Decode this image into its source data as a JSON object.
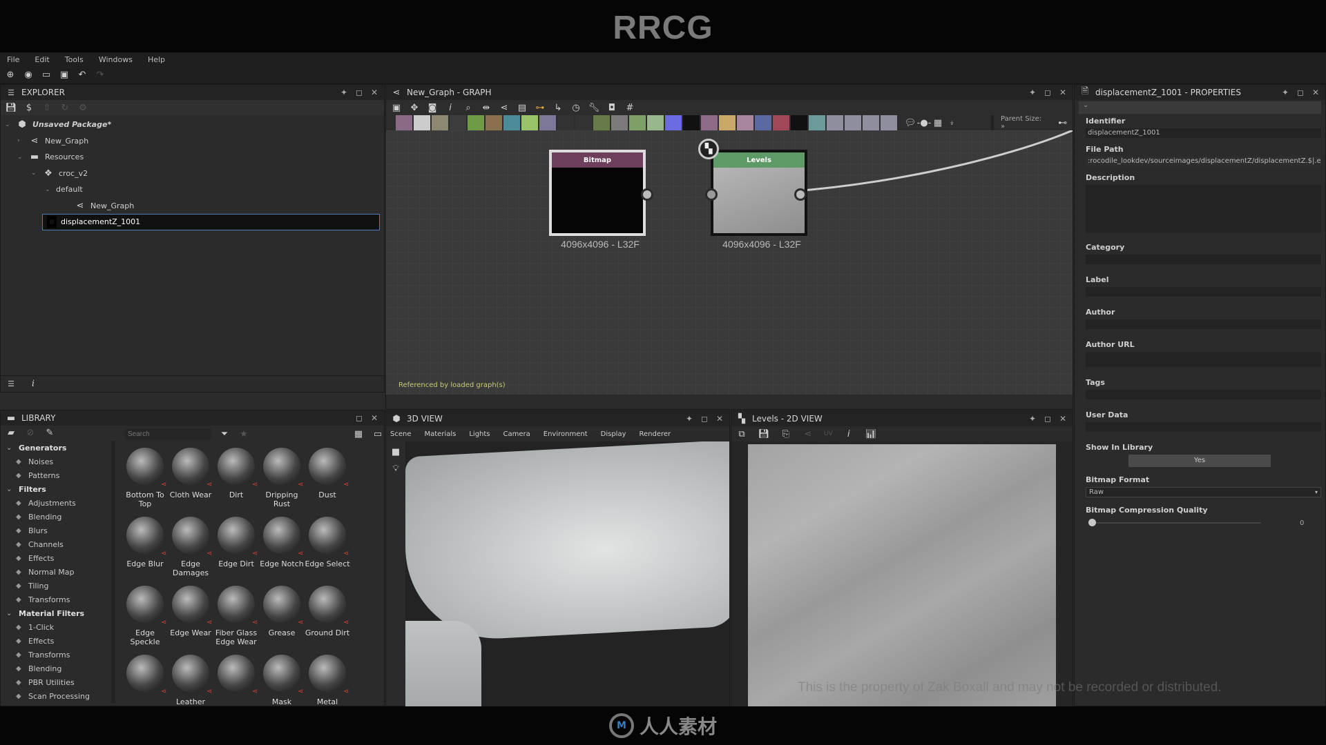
{
  "watermark": {
    "top_logo": "RRCG",
    "bottom_logo": "人人素材",
    "overlay_notice": "This is the property of Zak Boxall and may not be recorded or distributed."
  },
  "menu": [
    "File",
    "Edit",
    "Tools",
    "Windows",
    "Help"
  ],
  "main_toolbar_icons": [
    "new-package-icon",
    "new-graph-icon",
    "open-folder-icon",
    "save-all-icon",
    "undo-icon",
    "redo-icon"
  ],
  "explorer": {
    "title": "EXPLORER",
    "tree": [
      {
        "label": "Unsaved Package*",
        "icon": "package-icon",
        "level": 0,
        "expanded": true
      },
      {
        "label": "New_Graph",
        "icon": "graph-icon",
        "level": 1,
        "expanded": false
      },
      {
        "label": "Resources",
        "icon": "folder-icon",
        "level": 1,
        "expanded": true
      },
      {
        "label": "croc_v2",
        "icon": "mesh-icon",
        "level": 2,
        "expanded": true
      },
      {
        "label": "default",
        "icon": "",
        "level": 3,
        "expanded": true
      },
      {
        "label": "New_Graph",
        "icon": "graph-icon",
        "level": 4
      },
      {
        "label": "displacementZ_1001",
        "icon": "bitmap-icon",
        "level": 2,
        "selected": true
      }
    ]
  },
  "graph": {
    "title": "New_Graph - GRAPH",
    "parent_size_label": "Parent Size: »",
    "status_text": "Referenced by loaded graph(s)",
    "nodes": [
      {
        "name": "Bitmap",
        "resolution": "4096x4096 - L32F",
        "header_color": "#6e3f5c"
      },
      {
        "name": "Levels",
        "resolution": "4096x4096 - L32F",
        "header_color": "#5e9a66"
      }
    ]
  },
  "properties": {
    "title": "displacementZ_1001 - PROPERTIES",
    "fields": [
      {
        "label": "Identifier",
        "value": "displacementZ_1001"
      },
      {
        "label": "File Path",
        "value": ":rocodile_lookdev/sourceimages/displacementZ/displacementZ.$|.exr"
      },
      {
        "label": "Description",
        "value": ""
      },
      {
        "label": "Category",
        "value": ""
      },
      {
        "label": "Label",
        "value": ""
      },
      {
        "label": "Author",
        "value": ""
      },
      {
        "label": "Author URL",
        "value": ""
      },
      {
        "label": "Tags",
        "value": ""
      },
      {
        "label": "User Data",
        "value": ""
      }
    ],
    "show_in_library": {
      "label": "Show In Library",
      "value": "Yes"
    },
    "bitmap_format": {
      "label": "Bitmap Format",
      "value": "Raw"
    },
    "compression": {
      "label": "Bitmap Compression Quality",
      "value": "0",
      "fraction": 0
    }
  },
  "library": {
    "title": "LIBRARY",
    "search_placeholder": "Search",
    "categories": [
      {
        "label": "Generators",
        "head": true
      },
      {
        "label": "Noises"
      },
      {
        "label": "Patterns"
      },
      {
        "label": "Filters",
        "head": true
      },
      {
        "label": "Adjustments"
      },
      {
        "label": "Blending"
      },
      {
        "label": "Blurs"
      },
      {
        "label": "Channels"
      },
      {
        "label": "Effects"
      },
      {
        "label": "Normal Map"
      },
      {
        "label": "Tiling"
      },
      {
        "label": "Transforms"
      },
      {
        "label": "Material Filters",
        "head": true
      },
      {
        "label": "1-Click"
      },
      {
        "label": "Effects"
      },
      {
        "label": "Transforms"
      },
      {
        "label": "Blending"
      },
      {
        "label": "PBR Utilities"
      },
      {
        "label": "Scan Processing"
      }
    ],
    "items": [
      "Bottom To Top",
      "Cloth Wear",
      "Dirt",
      "Dripping Rust",
      "Dust",
      "Edge Blur",
      "Edge Damages",
      "Edge Dirt",
      "Edge Notch",
      "Edge Select",
      "Edge Speckle",
      "Edge Wear",
      "Fiber Glass Edge Wear",
      "Grease",
      "Ground Dirt",
      "",
      "Leather",
      "",
      "Mask",
      "Metal"
    ]
  },
  "view3d": {
    "title": "3D VIEW",
    "menu": [
      "Scene",
      "Materials",
      "Lights",
      "Camera",
      "Environment",
      "Display",
      "Renderer"
    ]
  },
  "view2d": {
    "title": "Levels - 2D VIEW",
    "uv_label": "UV"
  }
}
